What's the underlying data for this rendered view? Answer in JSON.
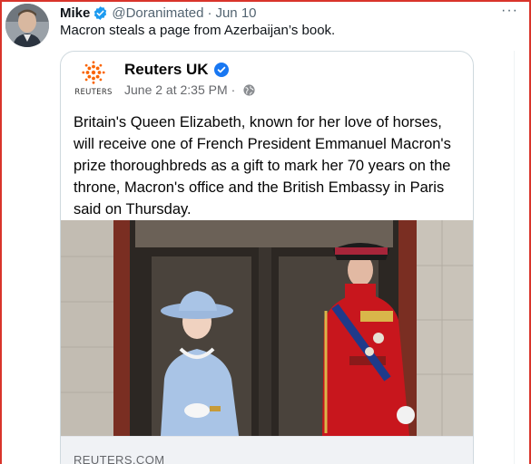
{
  "tweet": {
    "author_name": "Mike",
    "author_handle": "@Doranimated",
    "separator": "·",
    "date": "Jun 10",
    "text": "Macron steals a page from Azerbaijan’s book.",
    "more_icon": "more-horizontal-icon"
  },
  "embedded_post": {
    "page_name": "Reuters UK",
    "logo_text": "REUTERS",
    "timestamp": "June 2 at 2:35 PM",
    "separator": "·",
    "privacy_icon": "globe-icon",
    "body": "Britain's Queen Elizabeth, known for her love of horses, will receive one of French President Emmanuel Macron's prize thoroughbreds as a gift to mark her 70 years on the throne, Macron's office and the British Embassy in Paris said on Thursday.",
    "link_domain": "REUTERS.COM"
  },
  "colors": {
    "verified_blue": "#1d9bf0",
    "fb_verified_blue": "#1877f2",
    "reuters_orange": "#fa6400",
    "frame_red": "#d9342b",
    "queen_outfit": "#a9c4e6",
    "uniform_red": "#c8161d"
  }
}
